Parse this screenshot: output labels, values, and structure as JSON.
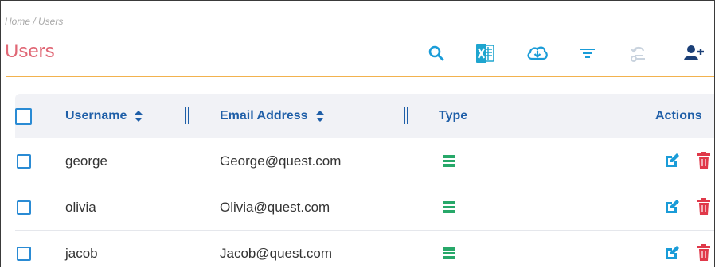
{
  "breadcrumb": "Home / Users",
  "page_title": "Users",
  "toolbar": {
    "icons": [
      "search-icon",
      "excel-export-icon",
      "cloud-download-icon",
      "filter-icon",
      "reset-icon",
      "add-user-icon"
    ]
  },
  "colors": {
    "title": "#e06775",
    "accent": "#1f5fa8",
    "checkbox": "#2a8bd4",
    "type_icon": "#27a869",
    "edit_icon": "#1a9cd8",
    "delete_icon": "#e0394a",
    "divider": "#f2b24e",
    "excel": "#1ea5cf"
  },
  "table": {
    "columns": {
      "username": "Username",
      "email": "Email Address",
      "type": "Type",
      "actions": "Actions"
    },
    "rows": [
      {
        "username": "george",
        "email": "George@quest.com"
      },
      {
        "username": "olivia",
        "email": "Olivia@quest.com"
      },
      {
        "username": "jacob",
        "email": "Jacob@quest.com"
      }
    ]
  }
}
